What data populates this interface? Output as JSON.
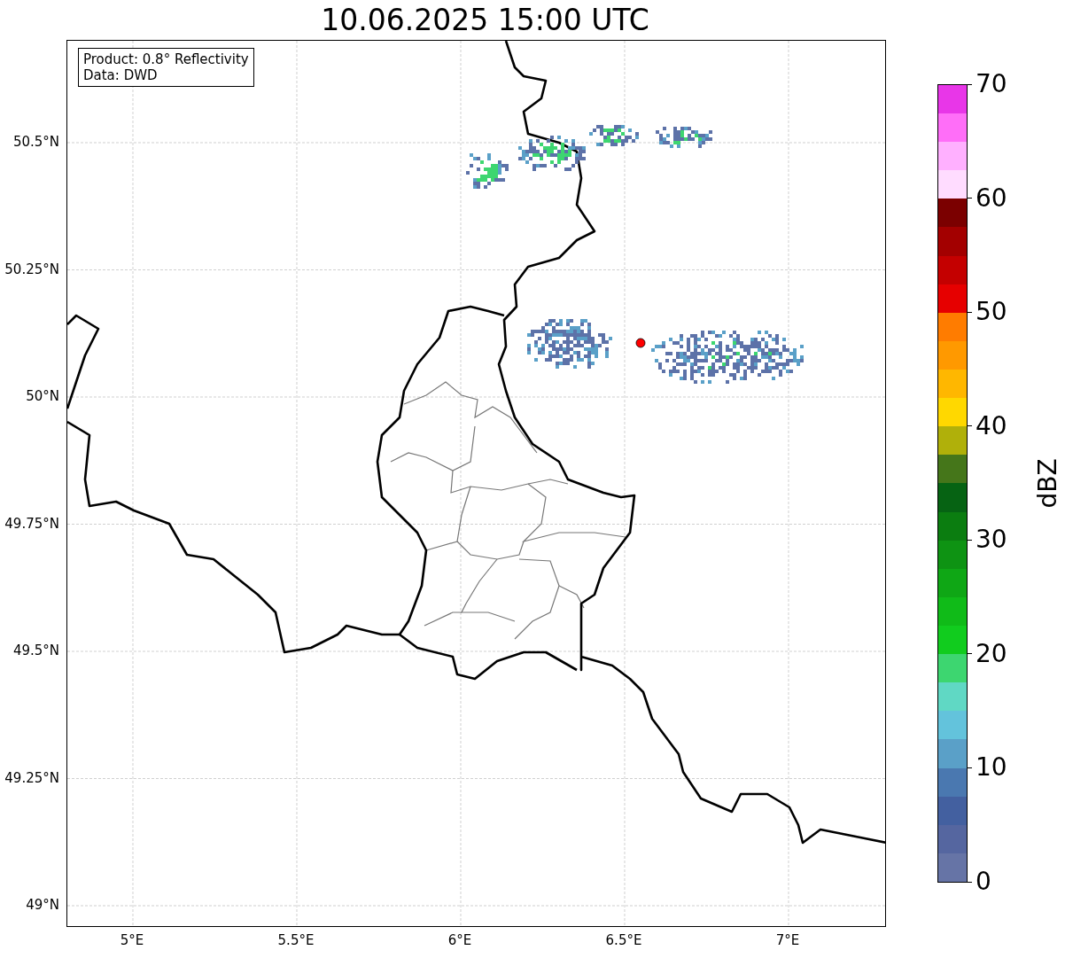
{
  "title": "10.06.2025 15:00 UTC",
  "info_box": {
    "lines": [
      "Product: 0.8° Reflectivity",
      "Data: DWD"
    ]
  },
  "map": {
    "lat_labels": [
      "50.5°N",
      "50.25°N",
      "50°N",
      "49.75°N",
      "49.5°N",
      "49.25°N",
      "49°N"
    ],
    "lon_labels": [
      "5°E",
      "5.5°E",
      "6°E",
      "6.5°E",
      "7°E"
    ]
  },
  "colorbar": {
    "label": "dBZ",
    "ticks": [
      "70",
      "60",
      "50",
      "40",
      "30",
      "20",
      "10",
      "0"
    ],
    "bins": [
      {
        "color": "#6674a6"
      },
      {
        "color": "#5566a0"
      },
      {
        "color": "#4360a0"
      },
      {
        "color": "#4a78b0"
      },
      {
        "color": "#5aa0c8"
      },
      {
        "color": "#63c3dc"
      },
      {
        "color": "#60d8c4"
      },
      {
        "color": "#3dd670"
      },
      {
        "color": "#11cc1e"
      },
      {
        "color": "#10bb18"
      },
      {
        "color": "#0fa715"
      },
      {
        "color": "#0e9313"
      },
      {
        "color": "#0b7d10"
      },
      {
        "color": "#066313"
      },
      {
        "color": "#45761a"
      },
      {
        "color": "#b0b00a"
      },
      {
        "color": "#ffd800"
      },
      {
        "color": "#ffb700"
      },
      {
        "color": "#ff9900"
      },
      {
        "color": "#ff7c00"
      },
      {
        "color": "#e60000"
      },
      {
        "color": "#c40000"
      },
      {
        "color": "#a30000"
      },
      {
        "color": "#7b0000"
      },
      {
        "color": "#ffdcff"
      },
      {
        "color": "#ffb0ff"
      },
      {
        "color": "#ff6ef8"
      },
      {
        "color": "#e836e8"
      }
    ]
  }
}
